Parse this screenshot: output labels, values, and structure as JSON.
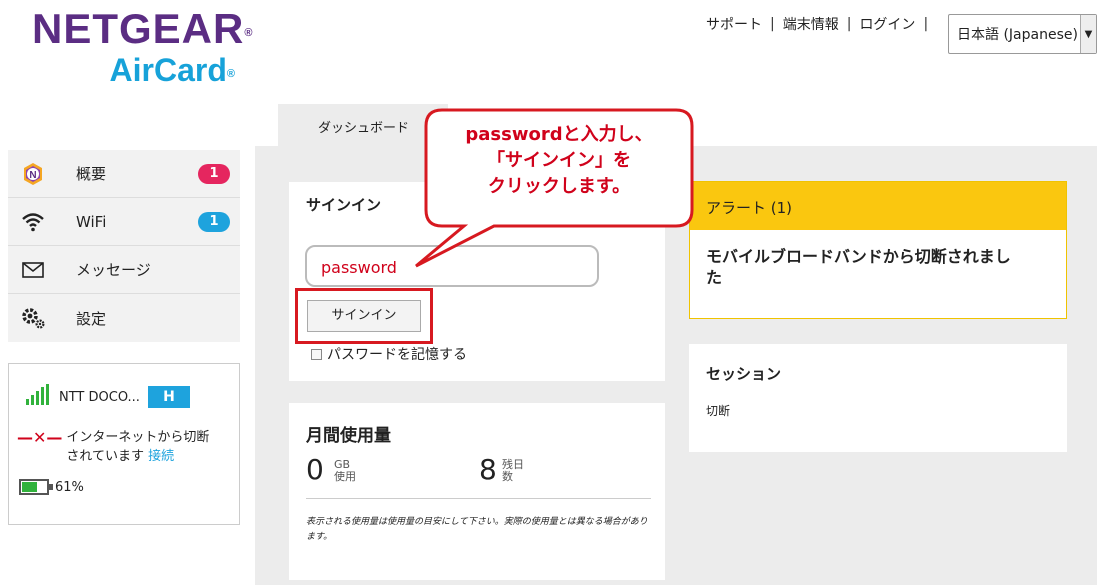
{
  "logo": {
    "line1": "NETGEAR",
    "line2": "AirCard",
    "reg": "®"
  },
  "topnav": {
    "support": "サポート",
    "device_info": "端末情報",
    "login": "ログイン",
    "separator": "|",
    "language": "日本語 (Japanese)"
  },
  "tab": {
    "dashboard": "ダッシュボード"
  },
  "sidebar": {
    "items": [
      {
        "label": "概要",
        "badge": "1",
        "badge_color": "#e5265f"
      },
      {
        "label": "WiFi",
        "badge": "1",
        "badge_color": "#1ea3dd"
      },
      {
        "label": "メッセージ",
        "badge": null
      },
      {
        "label": "設定",
        "badge": null
      }
    ]
  },
  "status": {
    "carrier": "NTT DOCO...",
    "network_type": "H",
    "connection_line1": "インターネットから切断",
    "connection_line2": "されています",
    "connect_link": "接続",
    "battery_label": "61%",
    "battery_level": 0.61
  },
  "signin": {
    "title": "サインイン",
    "password_value": "password",
    "button": "サインイン",
    "remember": "パスワードを記憶する"
  },
  "usage": {
    "title": "月間使用量",
    "used_value": "0",
    "used_unit_1": "GB",
    "used_unit_2": "使用",
    "days_value": "8",
    "days_unit_1": "残日",
    "days_unit_2": "数",
    "note": "表示される使用量は使用量の目安にして下さい。実際の使用量とは異なる場合があります。"
  },
  "alert": {
    "title": "アラート (1)",
    "message": "モバイルブロードバンドから切断されました"
  },
  "session": {
    "title": "セッション",
    "value": "切断"
  },
  "callout": {
    "line1": "passwordと入力し、",
    "line2": "「サインイン」を",
    "line3": "クリックします。"
  },
  "colors": {
    "brand_purple": "#5b2d83",
    "brand_blue": "#17a2d9",
    "alert_yellow": "#fac70f",
    "highlight_red": "#d71920"
  }
}
